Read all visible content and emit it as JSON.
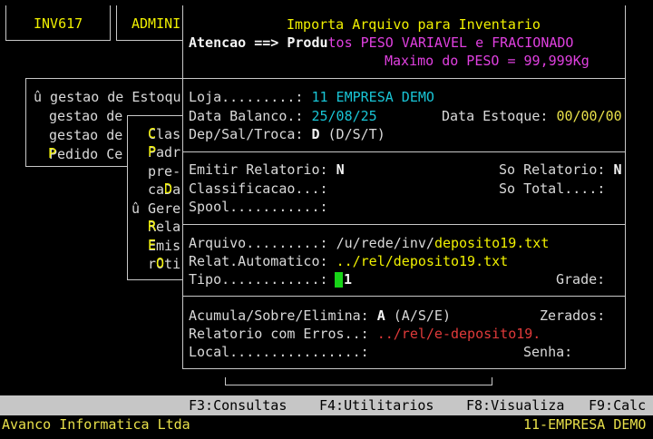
{
  "tabs": [
    {
      "label": "INV617"
    },
    {
      "label": "ADMINI"
    }
  ],
  "background_menu": {
    "items": [
      "û gestao de Estoqu",
      "gestao de",
      "gestao de",
      "Pedido Ce"
    ]
  },
  "submenu": {
    "items": [
      "Clas",
      "Padr",
      "pre-",
      "caDa",
      "û Gere",
      "Rela",
      "Emis",
      "rOti"
    ]
  },
  "dialog": {
    "title": "Importa Arquivo para Inventario",
    "warning_prefix": "Atencao ==> Produ",
    "warning_text": "tos PESO VARIAVEL e FRACIONADO",
    "max_peso": "Maximo do PESO = 99,999Kg",
    "fields": {
      "loja_label": "Loja.........:",
      "loja_value": "11 EMPRESA DEMO",
      "data_balanco_label": "Data Balanco.:",
      "data_balanco_value": "25/08/25",
      "data_estoque_label": "Data Estoque:",
      "data_estoque_value": "00/00/00",
      "dep_label": "Dep/Sal/Troca:",
      "dep_value": "D",
      "dep_options": "(D/S/T)",
      "emitir_label": "Emitir Relatorio:",
      "emitir_value": "N",
      "so_relatorio_label": "So Relatorio:",
      "so_relatorio_value": "N",
      "classificacao_label": "Classificacao...:",
      "so_total_label": "So Total....:",
      "spool_label": "Spool...........:",
      "arquivo_label": "Arquivo.........:",
      "arquivo_path": "/u/rede/inv/",
      "arquivo_file": "deposito19.txt",
      "relat_label": "Relat.Automatico:",
      "relat_value": "../rel/deposito19.txt",
      "tipo_label": "Tipo............:",
      "tipo_value": "1",
      "grade_label": "Grade:",
      "acumula_label": "Acumula/Sobre/Elimina:",
      "acumula_value": "A",
      "acumula_options": "(A/S/E)",
      "zerados_label": "Zerados:",
      "erros_label": "Relatorio com Erros..:",
      "erros_value": "../rel/e-deposito19.",
      "local_label": "Local................:",
      "senha_label": "Senha:"
    }
  },
  "function_keys": [
    {
      "label": "F3:Consultas"
    },
    {
      "label": "F4:Utilitarios"
    },
    {
      "label": "F8:Visualiza"
    },
    {
      "label": "F9:Calc"
    }
  ],
  "status": {
    "company_left": "Avanco Informatica Ltda",
    "company_right": "11-EMPRESA DEMO"
  },
  "colors": {
    "background": "#000000",
    "highlight_yellow": "#f0f000",
    "cyan_value": "#19c5d6",
    "magenta_warning": "#e040e0",
    "red_path": "#e03a3a",
    "cursor_green": "#17d417",
    "function_bar": "#c6c6c6"
  }
}
